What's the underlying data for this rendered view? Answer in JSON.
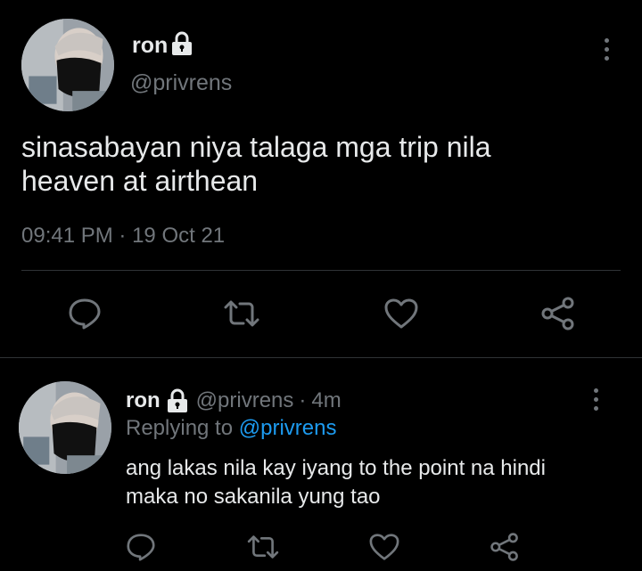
{
  "tweet": {
    "display_name": "ron",
    "handle": "@privrens",
    "text_line1": "sinasabayan niya talaga mga trip nila",
    "text_line2": "heaven at airthean",
    "time": "09:41 PM",
    "dot": "·",
    "date": "19 Oct 21"
  },
  "reply": {
    "display_name": "ron",
    "handle": "@privrens",
    "dot": "·",
    "age": "4m",
    "replying_prefix": "Replying to",
    "replying_handle": "@privrens",
    "text_line1": "ang lakas nila kay iyang to the point na hindi",
    "text_line2": "maka no sakanila yung tao"
  },
  "icons": {
    "reply": "comment-icon",
    "retweet": "retweet-icon",
    "like": "heart-icon",
    "share": "share-icon",
    "lock": "lock-icon",
    "more": "more-vertical-icon"
  },
  "colors": {
    "background": "#000000",
    "text": "#e7e9ea",
    "muted": "#71767b",
    "link": "#1d9bf0",
    "divider": "#2f3336"
  }
}
